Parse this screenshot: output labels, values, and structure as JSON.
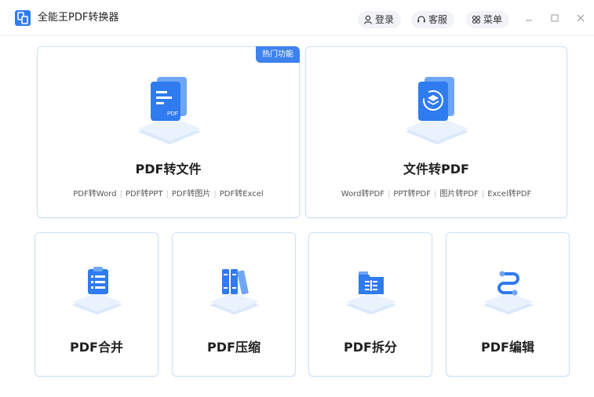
{
  "app": {
    "title": "全能王PDF转换器",
    "colors": {
      "accent": "#3d82ee",
      "card_border": "#cfe0f5",
      "illustration_base": "#e4eefc"
    }
  },
  "titlebar": {
    "login_label": "登录",
    "login_icon": "user-icon",
    "support_label": "客服",
    "support_icon": "headset-icon",
    "menu_label": "菜单",
    "menu_icon": "grid-icon",
    "window_controls": [
      "minimize-icon",
      "maximize-icon",
      "close-icon"
    ]
  },
  "cards": {
    "pdf_to_file": {
      "badge": "热门功能",
      "title": "PDF转文件",
      "subs": [
        "PDF转Word",
        "PDF转PPT",
        "PDF转图片",
        "PDF转Excel"
      ],
      "icon": "pdf-document-icon",
      "icon_text": "PDF"
    },
    "file_to_pdf": {
      "title": "文件转PDF",
      "subs": [
        "Word转PDF",
        "PPT转PDF",
        "图片转PDF",
        "Excel转PDF"
      ],
      "icon": "convert-document-icon"
    },
    "merge": {
      "title": "PDF合并",
      "icon": "clipboard-list-icon"
    },
    "compress": {
      "title": "PDF压缩",
      "icon": "binders-icon"
    },
    "split": {
      "title": "PDF拆分",
      "icon": "split-folder-icon"
    },
    "edit": {
      "title": "PDF编辑",
      "icon": "edit-curve-icon"
    }
  }
}
